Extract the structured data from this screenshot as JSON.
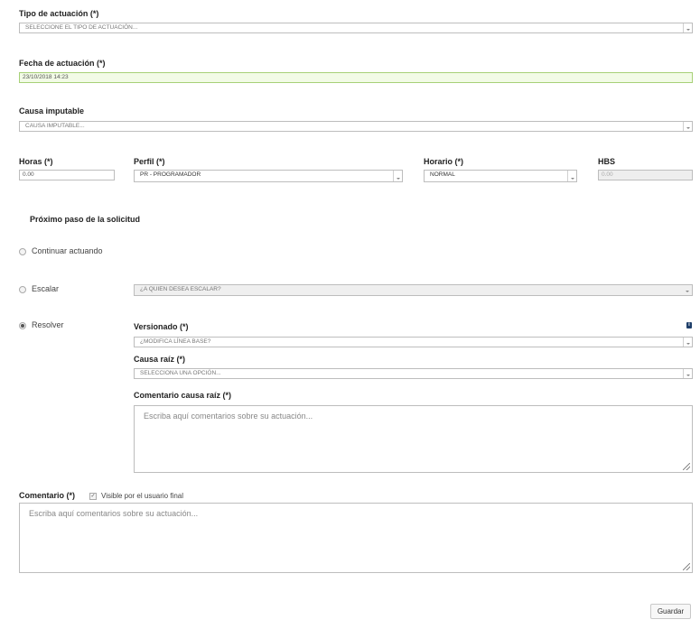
{
  "tipo": {
    "label": "Tipo de actuación (*)",
    "placeholder": "SELECCIONE EL TIPO DE ACTUACIÓN..."
  },
  "fecha": {
    "label": "Fecha de actuación (*)",
    "value": "23/10/2018 14:23"
  },
  "causa_imputable": {
    "label": "Causa imputable",
    "placeholder": "CAUSA IMPUTABLE..."
  },
  "horas": {
    "label": "Horas (*)",
    "value": "0.00"
  },
  "perfil": {
    "label": "Perfil (*)",
    "value": "PR - PROGRAMADOR"
  },
  "horario": {
    "label": "Horario (*)",
    "value": "NORMAL"
  },
  "hbs": {
    "label": "HBS",
    "value": "0.00"
  },
  "proximo_paso": {
    "title": "Próximo paso de la solicitud",
    "options": {
      "continuar": "Continuar actuando",
      "escalar": "Escalar",
      "resolver": "Resolver"
    },
    "selected": "resolver",
    "escalar_placeholder": "¿A QUIEN DESEA ESCALAR?"
  },
  "resolver": {
    "versionado_label": "Versionado (*)",
    "versionado_placeholder": "¿MODIFICA LÍNEA BASE?",
    "causa_raiz_label": "Causa raíz (*)",
    "causa_raiz_placeholder": "SELECCIONA UNA OPCIÓN...",
    "comentario_causa_label": "Comentario causa raíz (*)",
    "comentario_causa_placeholder": "Escriba aquí comentarios sobre su actuación..."
  },
  "comentario": {
    "label": "Comentario (*)",
    "visible_label": "Visible por el usuario final",
    "visible_checked": true,
    "placeholder": "Escriba aquí comentarios sobre su actuación..."
  },
  "guardar_label": "Guardar",
  "icons": {
    "info": "info-icon",
    "dropdown": "chevron-down-icon",
    "check": "✓"
  }
}
